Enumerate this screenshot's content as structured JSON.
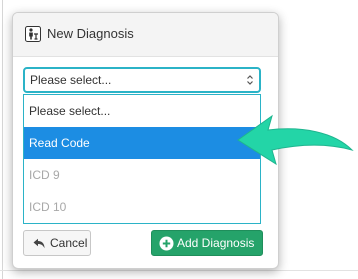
{
  "modal": {
    "title": "New Diagnosis",
    "icon": "person-hierarchy-icon"
  },
  "select": {
    "value": "Please select...",
    "caret_icon": "sort-caret-icon"
  },
  "dropdown": {
    "options": [
      {
        "label": "Please select...",
        "state": "normal"
      },
      {
        "label": "Read Code",
        "state": "highlighted"
      },
      {
        "label": "ICD 9",
        "state": "disabled"
      },
      {
        "label": "ICD 10",
        "state": "disabled"
      }
    ]
  },
  "buttons": {
    "cancel_label": "Cancel",
    "cancel_icon": "undo-arrow-icon",
    "add_label": "Add Diagnosis",
    "add_icon": "plus-circle-icon"
  },
  "annotation": {
    "icon": "pointer-arrow-icon"
  },
  "colors": {
    "focus_border": "#2bb3c7",
    "selected_option_bg": "#1c8de3",
    "add_button_bg": "#25a36a",
    "arrow_fill": "#23d5a7"
  }
}
